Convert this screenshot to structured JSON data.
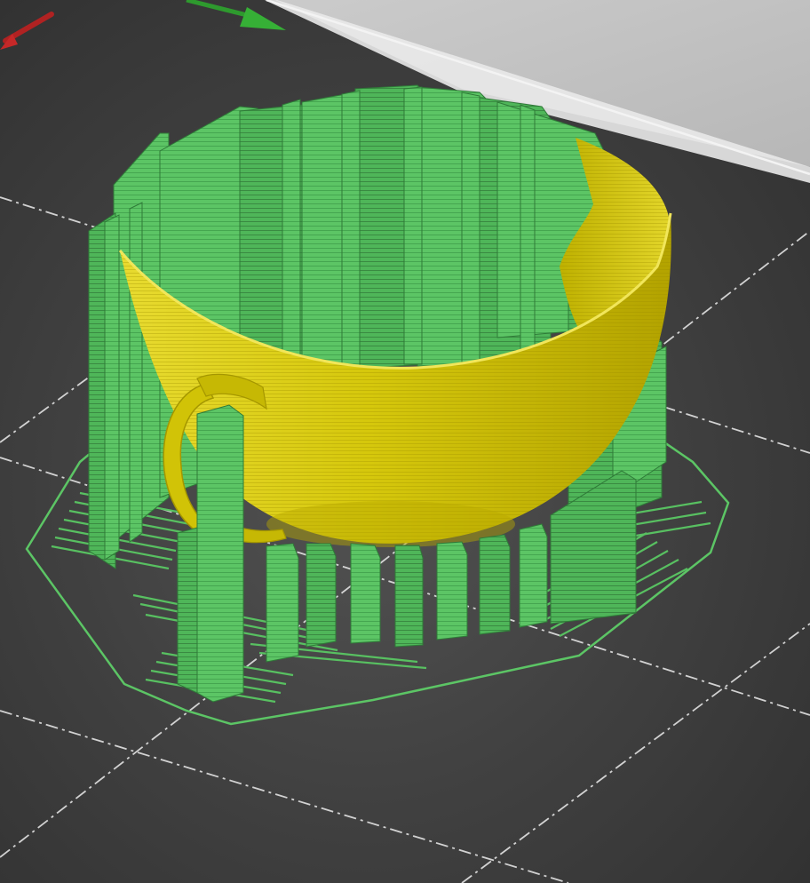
{
  "viewer": {
    "colors": {
      "bed_background": "#3f3f3f",
      "bed_grid": "#e8e8e8",
      "bed_edge": "#cfcfcf",
      "sky": "#c2c2c2",
      "support": "#5cc565",
      "support_dark": "#3f9e4a",
      "support_outline": "#2f7a38",
      "object": "#d7c90a",
      "object_dark": "#a89a00",
      "object_highlight": "#e9dd3a",
      "axis_x": "#c62828",
      "axis_y": "#2e9a2e"
    },
    "icons": {
      "axis_x": "x-axis-arrow-icon",
      "axis_y": "y-axis-arrow-icon"
    }
  }
}
